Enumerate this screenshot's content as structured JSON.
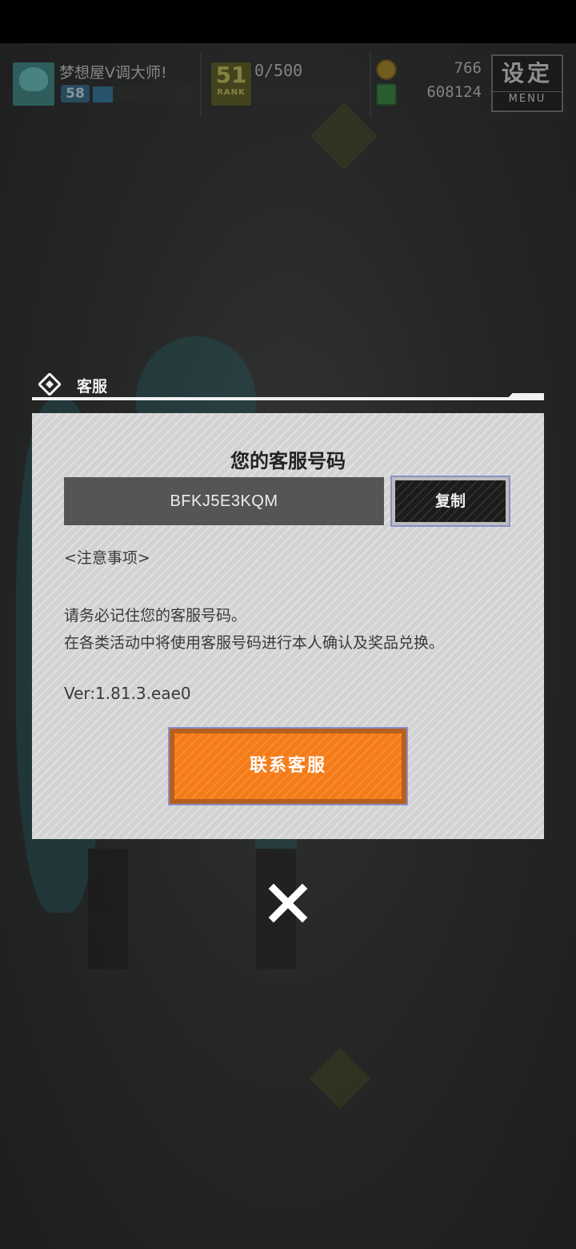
{
  "hud": {
    "player_name": "梦想屋V调大师!",
    "level": "58",
    "xp_fraction": 0.2,
    "rank_number": "51",
    "rank_label": "RANK",
    "rank_progress": "0/500",
    "coins": "766",
    "gems": "608124",
    "menu_label": "设定",
    "menu_sub_label": "MENU"
  },
  "dialog": {
    "title": "客服",
    "heading": "您的客服号码",
    "code": "BFKJ5E3KQM",
    "copy_label": "复制",
    "notice_heading": "<注意事项>",
    "notice_line1": "请务必记住您的客服号码。",
    "notice_line2": "在各类活动中将使用客服号码进行本人确认及奖品兑换。",
    "version": "Ver:1.81.3.eae0",
    "contact_label": "联系客服"
  },
  "colors": {
    "accent_orange": "#f57b16",
    "dialog_bg": "#d3d3d3",
    "code_field_bg": "#555555"
  },
  "icons": {
    "dialog_icon": "support-diamond-icon",
    "close_icon": "close-icon"
  }
}
